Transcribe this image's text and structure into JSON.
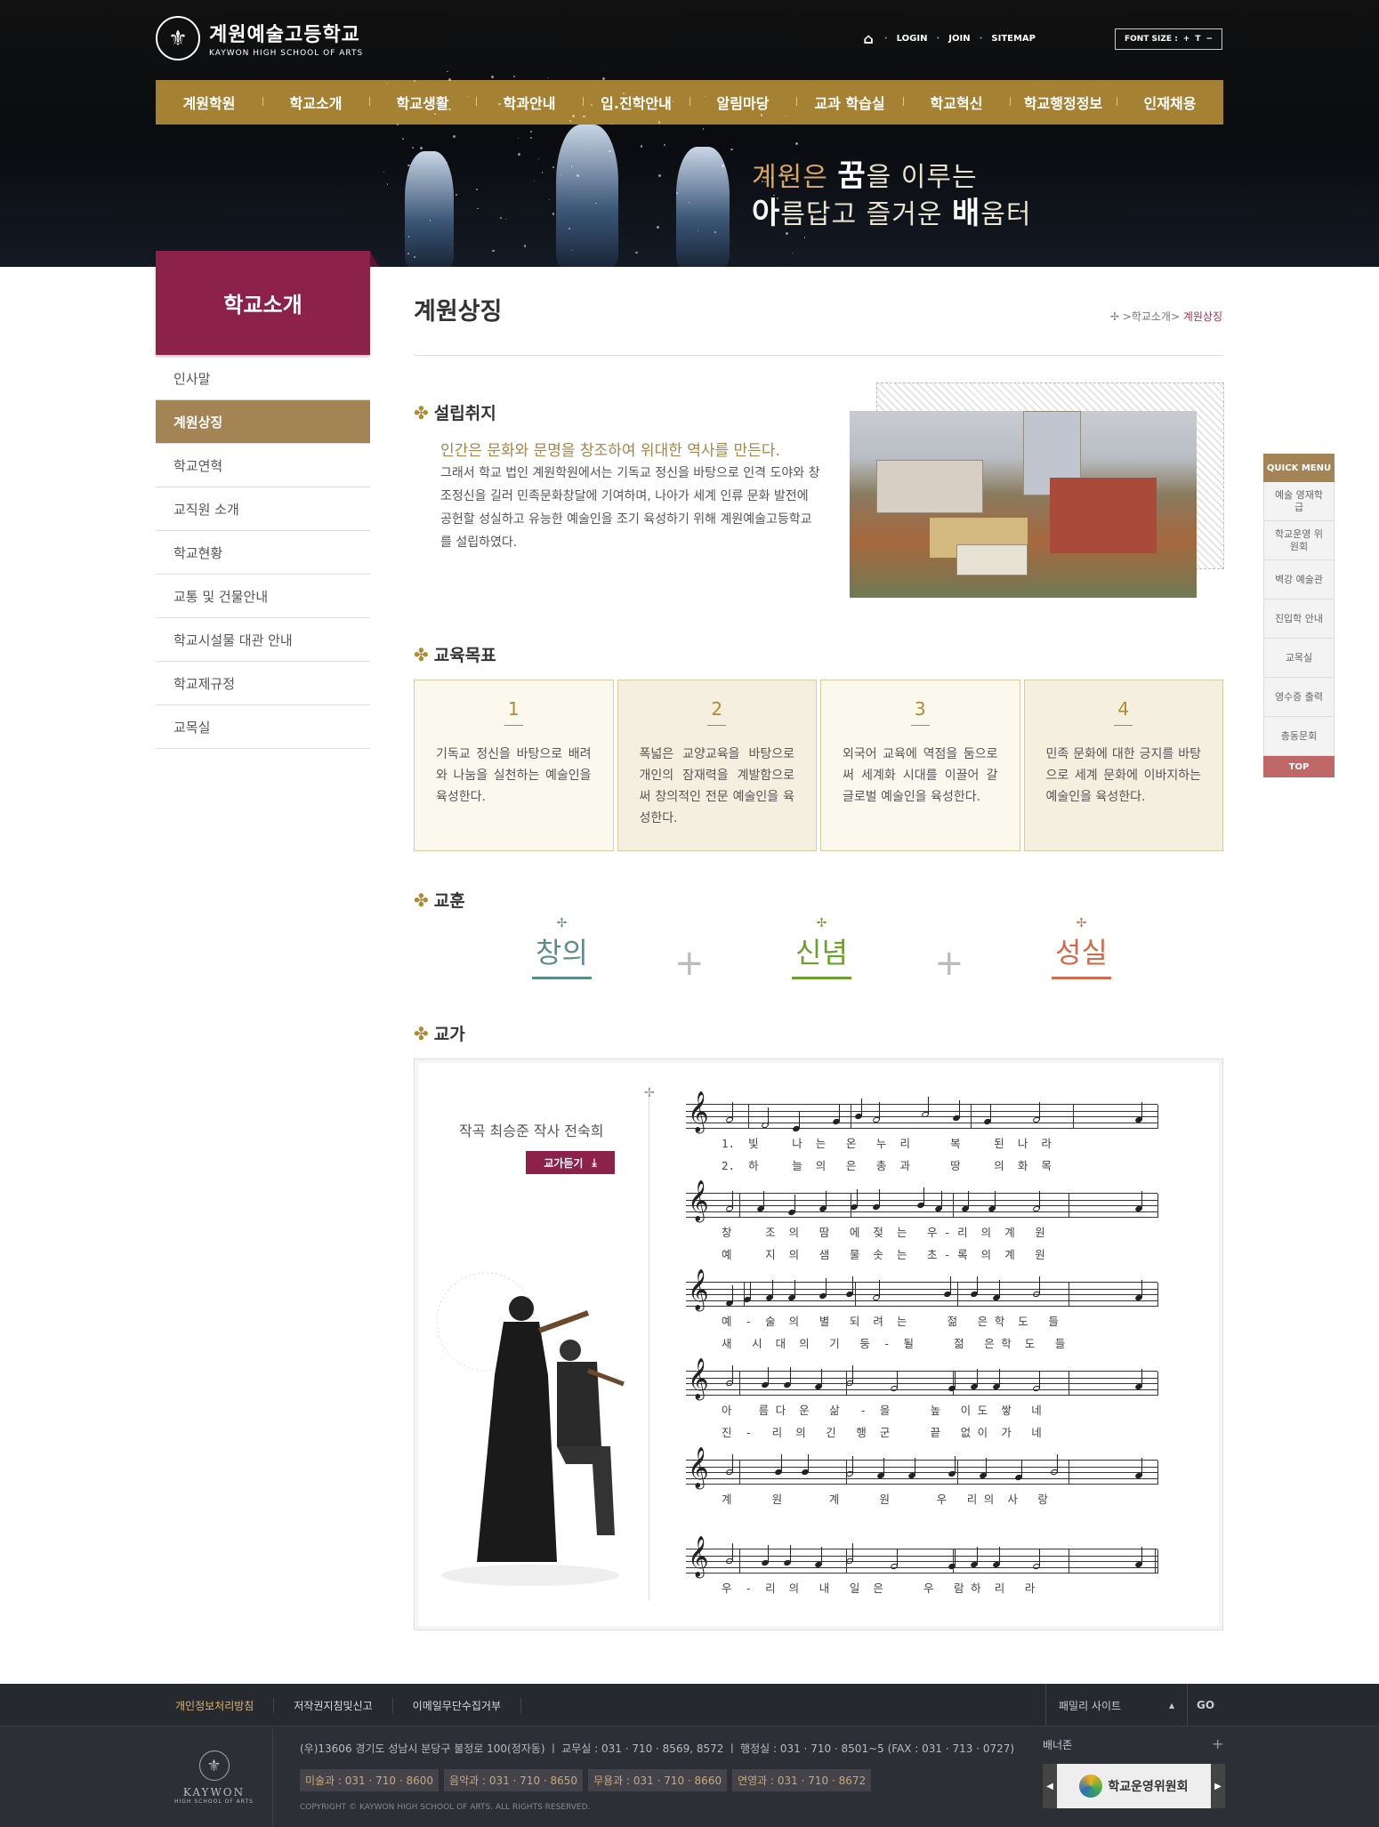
{
  "header": {
    "logo_title": "계원예술고등학교",
    "logo_sub": "KAYWON HIGH SCHOOL OF ARTS",
    "util": [
      "LOGIN",
      "JOIN",
      "SITEMAP"
    ],
    "font_size_label": "FONT SIZE :",
    "font_plus": "+",
    "font_t": "T",
    "font_minus": "−"
  },
  "gnb": [
    "계원학원",
    "학교소개",
    "학교생활",
    "학과안내",
    "입.진학안내",
    "알림마당",
    "교과 학습실",
    "학교혁신",
    "학교행정정보",
    "인재채용"
  ],
  "slogan": {
    "l1a": "계원은 ",
    "l1b": "꿈",
    "l1c": "을 이루는",
    "l2a": "아",
    "l2b": "름답고 즐거운 ",
    "l2c": "배",
    "l2d": "움터"
  },
  "lnb": {
    "title": "학교소개",
    "items": [
      "인사말",
      "계원상징",
      "학교연혁",
      "교직원 소개",
      "학교현황",
      "교통 및 건물안내",
      "학교시설물 대관 안내",
      "학교제규정",
      "교목실"
    ]
  },
  "content": {
    "title": "계원상징",
    "breadcrumb": [
      ">학교소개",
      "> ",
      "계원상징"
    ],
    "sec_intro": "설립취지",
    "intro_lead": "인간은 문화와 문명을 창조하여 위대한 역사를 만든다.",
    "intro_body": "그래서 학교 법인 계원학원에서는 기독교 정신을 바탕으로 인격 도야와 창조정신을 길러 민족문화창달에 기여하며, 나아가 세계 인류 문화 발전에 공헌할 성실하고 유능한 예술인을 조기 육성하기 위해 계원예술고등학교를 설립하였다.",
    "sec_goal": "교육목표",
    "goals": [
      {
        "n": "1",
        "t": "기독교 정신을 바탕으로 배려와 나눔을 실천하는 예술인을 육성한다."
      },
      {
        "n": "2",
        "t": "폭넓은 교양교육을 바탕으로 개인의 잠재력을 계발함으로써 창의적인 전문 예술인을 육성한다."
      },
      {
        "n": "3",
        "t": "외국어 교육에 역점을 둠으로써 세계화 시대를 이끌어 갈 글로벌 예술인을 육성한다."
      },
      {
        "n": "4",
        "t": "민족 문화에 대한 긍지를 바탕으로 세계 문화에 이바지하는 예술인을 육성한다."
      }
    ],
    "sec_motto": "교훈",
    "motto": [
      {
        "w": "창의",
        "c": "#5c8c8e"
      },
      {
        "w": "신념",
        "c": "#6aa12d"
      },
      {
        "w": "성실",
        "c": "#d36b4a"
      }
    ],
    "sec_song": "교가",
    "song_meta": "작곡 최승준   작사 전숙희",
    "song_btn": "교가듣기",
    "lyrics": [
      [
        "1.  빛     나  는   온   누  리      복     된  나  라",
        "2.  하     늘  의   은   총  과      땅     의  화  목"
      ],
      [
        "창     조  의   땀   에  젖  는   우 - 리  의  계   원",
        "예     지  의   샘   물  솟  는   초 - 록  의  계   원"
      ],
      [
        "예  -  술  의   별   되  려  는      젊   은 학  도   들",
        "새   시  대  의   기   둥  -  될      젊   은 학  도   들"
      ],
      [
        "아    름 다  운   삶   -  을      높   이 도  쌓   네",
        "진  -   리  의   긴   행  군      끝   없 이  가   네"
      ],
      [
        "계      원       계      원       우   리 의  사   랑"
      ],
      [
        "우  -  리  의   내   일  은      우   람 하  리   라"
      ]
    ]
  },
  "quick_menu": {
    "title": "QUICK MENU",
    "items": [
      "예술 영재학급",
      "학교운영 위원회",
      "벽강 예술관",
      "진입학 안내",
      "교목실",
      "영수증 출력",
      "총동문회"
    ],
    "top": "TOP"
  },
  "footer": {
    "links": [
      "개인정보처리방침",
      "저작권지침및신고",
      "이메일무단수집거부"
    ],
    "family": "패밀리 사이트",
    "go": "GO",
    "logo_text": "KAYWON",
    "logo_sub": "HIGH SCHOOL OF ARTS",
    "address": "(우)13606 경기도 성남시 분당구 불정로 100(정자동)  ㅣ  교무실 : 031 · 710 · 8569, 8572  ㅣ  행정실 : 031 · 710 · 8501~5 (FAX : 031 · 713 · 0727)",
    "tels": [
      "미술과 : 031 · 710 · 8600",
      "음악과 : 031 · 710 · 8650",
      "무용과 : 031 · 710 · 8660",
      "연영과 : 031 · 710 · 8672"
    ],
    "copyright": "COPYRIGHT © KAYWON HIGH SCHOOL OF ARTS. ALL RIGHTS RESERVED.",
    "banner_title": "배너존",
    "banner_text": "학교운영위원회"
  }
}
